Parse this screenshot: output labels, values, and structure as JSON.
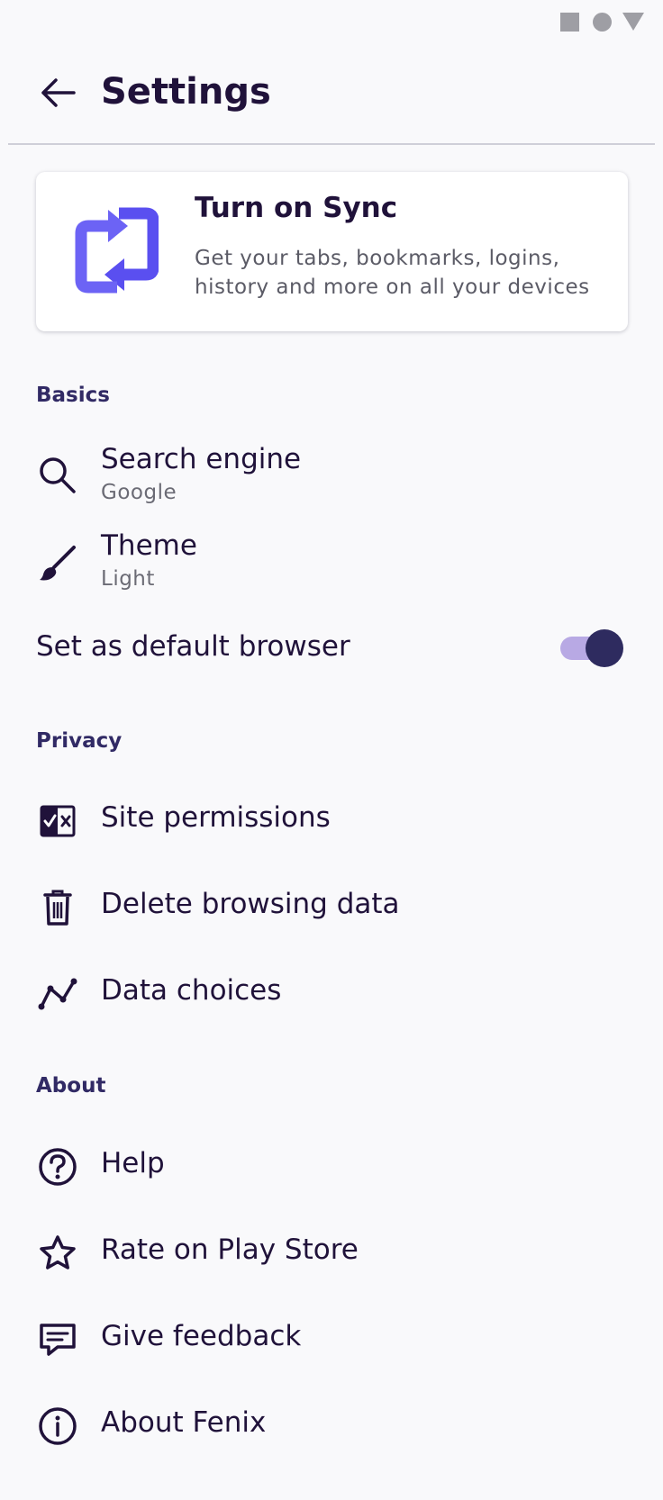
{
  "status_bar": {
    "icons": [
      "square-icon",
      "circle-icon",
      "triangle-icon"
    ]
  },
  "toolbar": {
    "title": "Settings",
    "back_icon": "back-arrow-icon"
  },
  "sync_card": {
    "title": "Turn on Sync",
    "description": "Get your tabs, bookmarks, logins, history and more on all your devices",
    "icon": "sync-icon",
    "accent_color": "#5a4ff0"
  },
  "sections": {
    "basics": "Basics",
    "privacy": "Privacy",
    "about": "About"
  },
  "basics": {
    "search_engine": {
      "title": "Search engine",
      "value": "Google",
      "icon": "search-icon"
    },
    "theme": {
      "title": "Theme",
      "value": "Light",
      "icon": "brush-icon"
    },
    "default_browser": {
      "title": "Set as default browser",
      "enabled": true
    }
  },
  "privacy": {
    "site_permissions": {
      "title": "Site permissions",
      "icon": "permissions-icon"
    },
    "delete_data": {
      "title": "Delete browsing data",
      "icon": "trash-icon"
    },
    "data_choices": {
      "title": "Data choices",
      "icon": "chart-line-icon"
    }
  },
  "about": {
    "help": {
      "title": "Help",
      "icon": "help-icon"
    },
    "rate": {
      "title": "Rate on Play Store",
      "icon": "star-icon"
    },
    "feedback": {
      "title": "Give feedback",
      "icon": "feedback-icon"
    },
    "about_fenix": {
      "title": "About Fenix",
      "icon": "info-icon"
    }
  },
  "colors": {
    "text_primary": "#20123a",
    "section_header": "#312a65",
    "toggle_track": "#b8a9e4",
    "toggle_thumb": "#2e2b5f"
  }
}
